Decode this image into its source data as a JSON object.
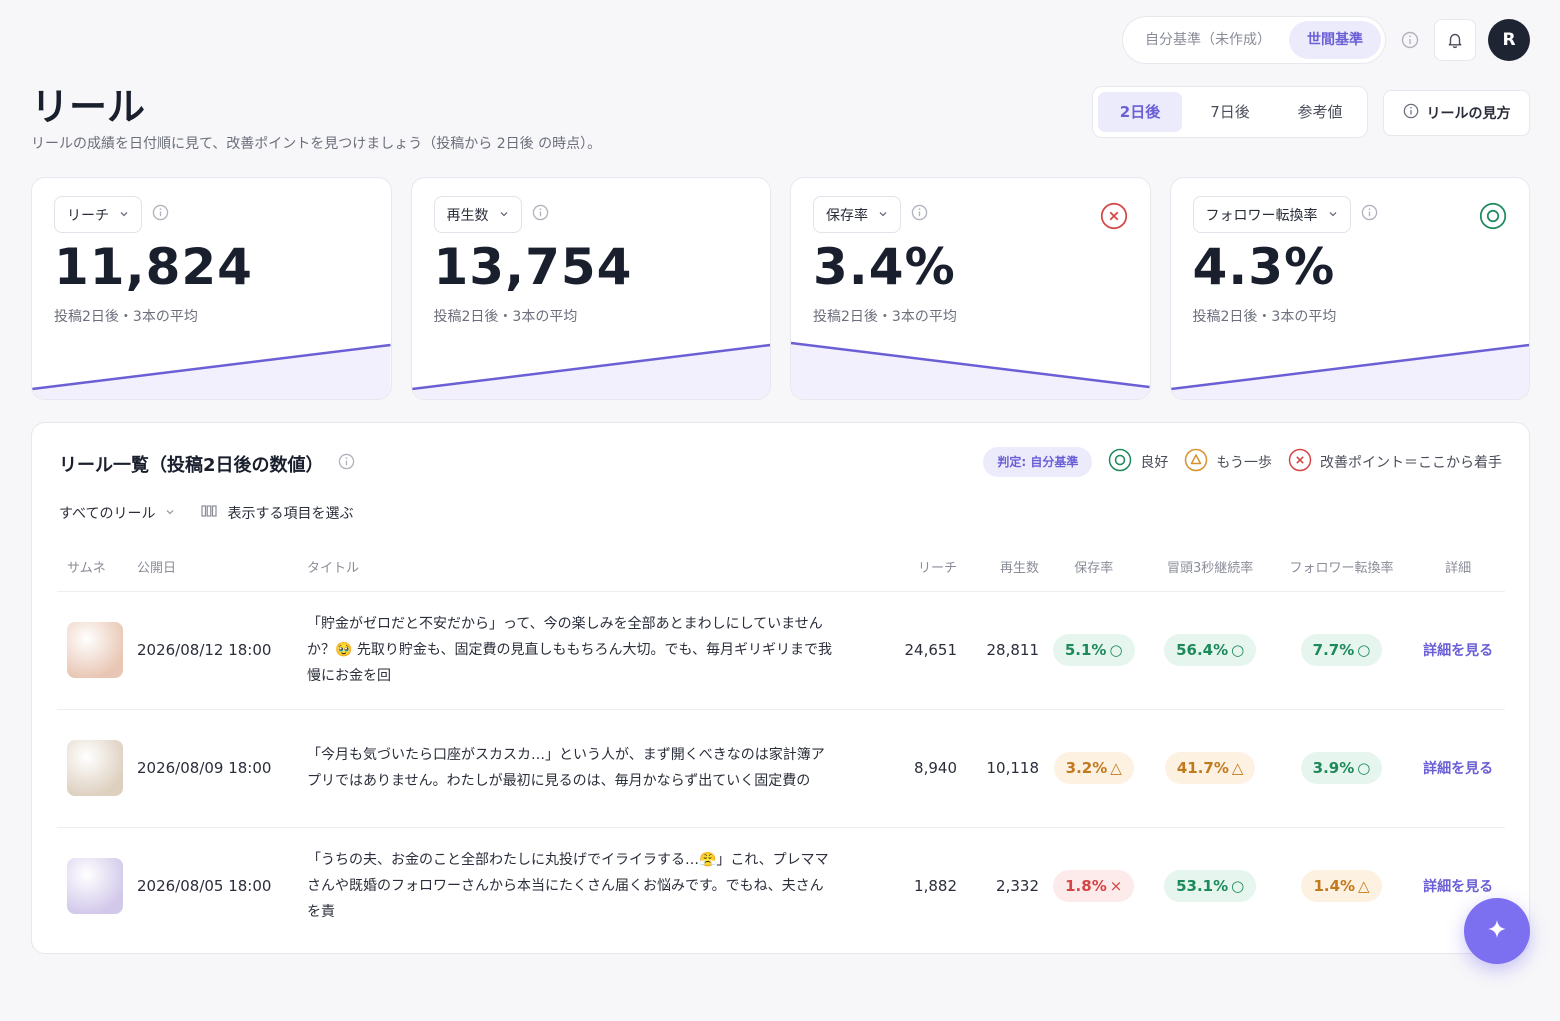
{
  "header": {
    "standard_self": "自分基準（未作成）",
    "standard_world": "世間基準",
    "avatar_initial": "R"
  },
  "page": {
    "title": "リール",
    "subtitle": "リールの成績を日付順に見て、改善ポイントを見つけましょう（投稿から 2日後 の時点）。"
  },
  "period_tabs": [
    "2日後",
    "7日後",
    "参考値"
  ],
  "howto_label": "リールの見方",
  "kpis": [
    {
      "metric": "リーチ",
      "value": "11,824",
      "note": "投稿2日後・3本の平均",
      "status": "none",
      "trend": "up"
    },
    {
      "metric": "再生数",
      "value": "13,754",
      "note": "投稿2日後・3本の平均",
      "status": "none",
      "trend": "up"
    },
    {
      "metric": "保存率",
      "value": "3.4%",
      "note": "投稿2日後・3本の平均",
      "status": "bad",
      "trend": "down"
    },
    {
      "metric": "フォロワー転換率",
      "value": "4.3%",
      "note": "投稿2日後・3本の平均",
      "status": "good",
      "trend": "up"
    }
  ],
  "list": {
    "title": "リール一覧（投稿2日後の数値）",
    "judge_badge": "判定: 自分基準",
    "legend": {
      "good": "良好",
      "warn": "もう一歩",
      "bad": "改善ポイント＝ここから着手"
    },
    "filter_all": "すべてのリール",
    "filter_columns": "表示する項目を選ぶ",
    "columns": [
      "サムネ",
      "公開日",
      "タイトル",
      "リーチ",
      "再生数",
      "保存率",
      "冒頭3秒継続率",
      "フォロワー転換率",
      "詳細"
    ],
    "rows": [
      {
        "date": "2026/08/12 18:00",
        "title": "「貯金がゼロだと不安だから」って、今の楽しみを全部あとまわしにしていませんか？🥹 先取り貯金も、固定費の見直しももちろん大切。でも、毎月ギリギリまで我慢にお金を回",
        "reach": "24,651",
        "plays": "28,811",
        "save": "5.1%",
        "save_status": "good",
        "hook": "56.4%",
        "hook_status": "good",
        "conv": "7.7%",
        "conv_status": "good",
        "detail": "詳細を見る",
        "thumb_color": "#e8c6b3"
      },
      {
        "date": "2026/08/09 18:00",
        "title": "「今月も気づいたら口座がスカスカ…」という人が、まず開くべきなのは家計簿アプリではありません。わたしが最初に見るのは、毎月かならず出ていく固定費の",
        "reach": "8,940",
        "plays": "10,118",
        "save": "3.2%",
        "save_status": "warn",
        "hook": "41.7%",
        "hook_status": "warn",
        "conv": "3.9%",
        "conv_status": "good",
        "detail": "詳細を見る",
        "thumb_color": "#ddd0bf"
      },
      {
        "date": "2026/08/05 18:00",
        "title": "「うちの夫、お金のこと全部わたしに丸投げでイライラする…😤」これ、プレママさんや既婚のフォロワーさんから本当にたくさん届くお悩みです。でもね、夫さんを責",
        "reach": "1,882",
        "plays": "2,332",
        "save": "1.8%",
        "save_status": "bad",
        "hook": "53.1%",
        "hook_status": "good",
        "conv": "1.4%",
        "conv_status": "warn",
        "detail": "詳細を見る",
        "thumb_color": "#d2c8ea"
      }
    ]
  },
  "colors": {
    "accent": "#6b5fd6",
    "good": "#1c8a5a",
    "warn": "#c27a1e",
    "bad": "#d64545"
  }
}
